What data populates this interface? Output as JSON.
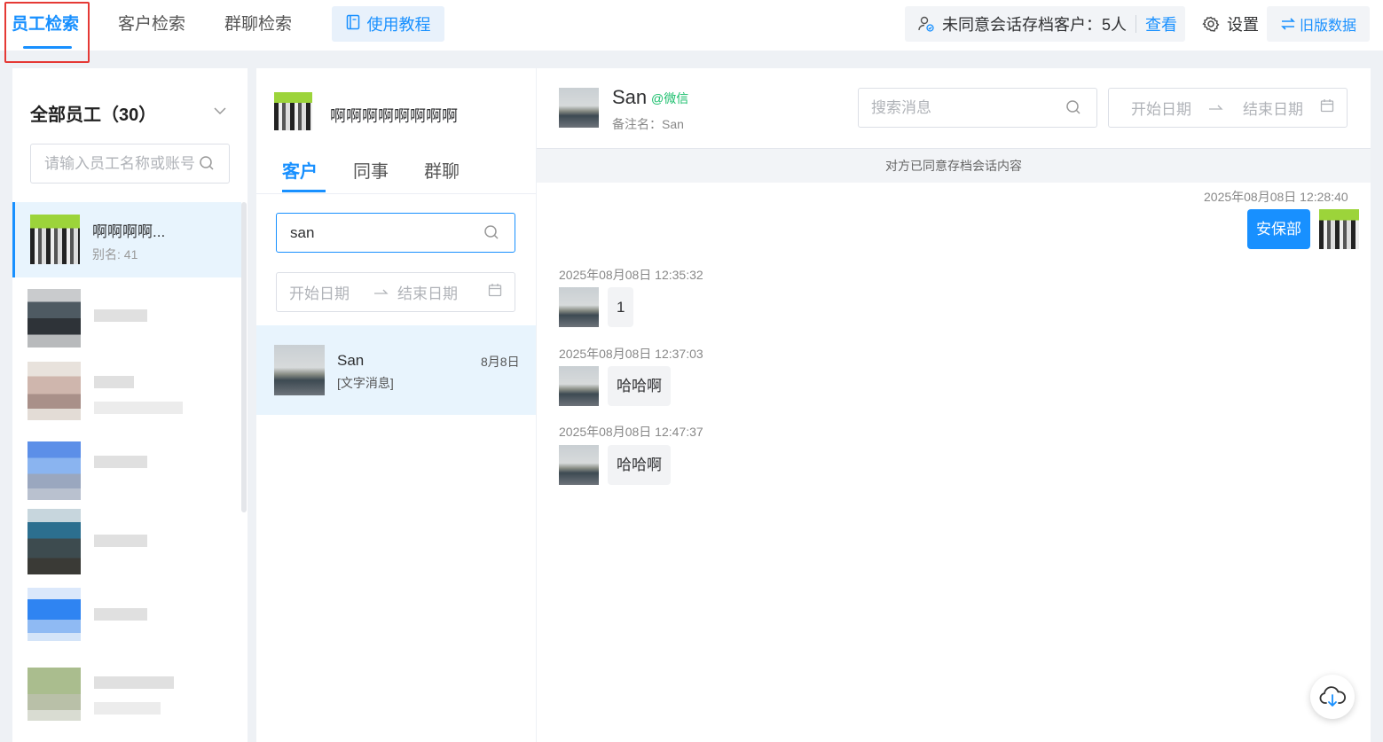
{
  "topbar": {
    "tabs": [
      {
        "label": "员工检索",
        "active": true
      },
      {
        "label": "客户检索",
        "active": false
      },
      {
        "label": "群聊检索",
        "active": false
      }
    ],
    "tutorial_label": "使用教程",
    "consent_label": "未同意会话存档客户：5人",
    "consent_link": "查看",
    "settings_label": "设置",
    "old_data_label": "旧版数据"
  },
  "employees": {
    "header": "全部员工（30）",
    "search_placeholder": "请输入员工名称或账号",
    "selected": {
      "name": "啊啊啊啊...",
      "alias": "别名: 41"
    }
  },
  "conversation_list": {
    "employee_name": "啊啊啊啊啊啊啊啊",
    "tabs": [
      {
        "label": "客户",
        "active": true
      },
      {
        "label": "同事",
        "active": false
      },
      {
        "label": "群聊",
        "active": false
      }
    ],
    "search_value": "san",
    "date_start": "开始日期",
    "date_end": "结束日期",
    "items": [
      {
        "name": "San",
        "date": "8月8日",
        "preview": "[文字消息]"
      }
    ]
  },
  "chat": {
    "contact_name": "San",
    "contact_tag": "@微信",
    "remark": "备注名：San",
    "search_placeholder": "搜索消息",
    "date_start": "开始日期",
    "date_end": "结束日期",
    "notice": "对方已同意存档会话内容",
    "messages": [
      {
        "time": "2025年08月08日 12:28:40",
        "text": "安保部",
        "direction": "out"
      },
      {
        "time": "2025年08月08日 12:35:32",
        "text": "1",
        "direction": "in"
      },
      {
        "time": "2025年08月08日 12:37:03",
        "text": "哈哈啊",
        "direction": "in"
      },
      {
        "time": "2025年08月08日 12:47:37",
        "text": "哈哈啊",
        "direction": "in"
      }
    ]
  },
  "colors": {
    "accent": "#1890ff",
    "wechat_green": "#19be6b",
    "highlight_red": "#e53935"
  }
}
